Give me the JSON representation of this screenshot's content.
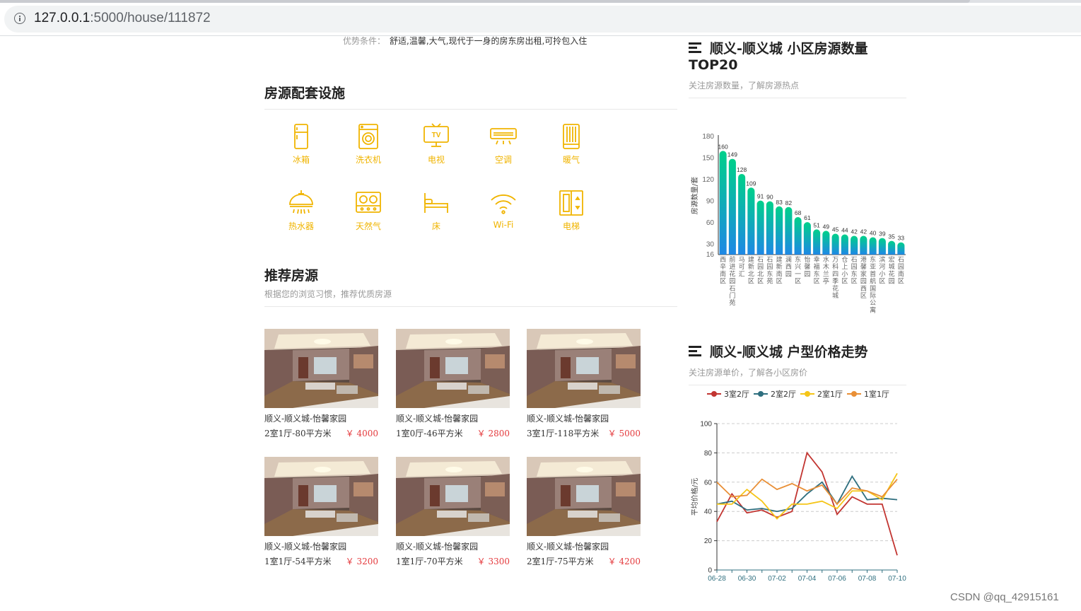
{
  "browser": {
    "url_host": "127.0.0.1",
    "url_path": ":5000/house/111872"
  },
  "advantage": {
    "label": "优势条件：",
    "value": "舒适,温馨,大气,现代于一身的房东房出租,可拎包入住"
  },
  "facilities": {
    "title": "房源配套设施",
    "items": [
      {
        "label": "冰箱",
        "icon": "fridge-icon"
      },
      {
        "label": "洗衣机",
        "icon": "washing-machine-icon"
      },
      {
        "label": "电视",
        "icon": "tv-icon"
      },
      {
        "label": "空调",
        "icon": "air-conditioner-icon"
      },
      {
        "label": "暖气",
        "icon": "heater-icon"
      },
      {
        "label": "热水器",
        "icon": "water-heater-icon"
      },
      {
        "label": "天然气",
        "icon": "gas-stove-icon"
      },
      {
        "label": "床",
        "icon": "bed-icon"
      },
      {
        "label": "Wi-Fi",
        "icon": "wifi-icon"
      },
      {
        "label": "电梯",
        "icon": "elevator-icon"
      }
    ]
  },
  "recommend": {
    "title": "推荐房源",
    "subtitle": "根据您的浏览习惯，推荐优质房源",
    "houses": [
      {
        "name": "顺义-顺义城-怡馨家园",
        "layout": "2室1厅-80平方米",
        "price": "￥ 4000"
      },
      {
        "name": "顺义-顺义城-怡馨家园",
        "layout": "1室0厅-46平方米",
        "price": "￥ 2800"
      },
      {
        "name": "顺义-顺义城-怡馨家园",
        "layout": "3室1厅-118平方米",
        "price": "￥ 5000"
      },
      {
        "name": "顺义-顺义城-怡馨家园",
        "layout": "1室1厅-54平方米",
        "price": "￥ 3200"
      },
      {
        "name": "顺义-顺义城-怡馨家园",
        "layout": "1室1厅-70平方米",
        "price": "￥ 3300"
      },
      {
        "name": "顺义-顺义城-怡馨家园",
        "layout": "2室1厅-75平方米",
        "price": "￥ 4200"
      }
    ]
  },
  "top_panel": {
    "title_line1": "顺义-顺义城 小区房源数量",
    "title_line2": "TOP20",
    "subtitle": "关注房源数量，了解房源热点"
  },
  "trend_panel": {
    "title": "顺义-顺义城 户型价格走势",
    "subtitle": "关注房源单价，了解各小区房价"
  },
  "watermark": "CSDN @qq_42915161",
  "colors": {
    "accent": "#f0b400",
    "price": "#e4393c",
    "bar_top": "#00d08a",
    "bar_bottom": "#1e88e5"
  },
  "chart_data": [
    {
      "type": "bar",
      "ylabel": "房源数量/套",
      "ylim": [
        16,
        180
      ],
      "yticks": [
        16,
        30,
        60,
        90,
        120,
        150,
        180
      ],
      "categories": [
        "西辛南区",
        "前进花园石门苑",
        "马可汇",
        "建新北区",
        "石园北区",
        "石园东苑",
        "建新南区",
        "澜西园",
        "东兴一区",
        "怡馨园",
        "幸福东区",
        "水木兰亭",
        "万科四季花城",
        "仓上小区",
        "石园东区",
        "港馨家园西区",
        "东亚首航国际公寓",
        "滨河小区",
        "宏城花园",
        "石园南区"
      ],
      "values": [
        160,
        149,
        128,
        109,
        91,
        90,
        83,
        82,
        68,
        61,
        51,
        49,
        45,
        44,
        42,
        42,
        40,
        39,
        35,
        33
      ]
    },
    {
      "type": "line",
      "ylabel": "平均价格/元",
      "ylim": [
        0,
        100
      ],
      "yticks": [
        0,
        20,
        40,
        60,
        80,
        100
      ],
      "x": [
        "06-28",
        "06-29",
        "06-30",
        "07-01",
        "07-02",
        "07-03",
        "07-04",
        "07-05",
        "07-06",
        "07-07",
        "07-08",
        "07-09",
        "07-10"
      ],
      "xtick_labels": [
        "06-28",
        "06-30",
        "07-02",
        "07-04",
        "07-06",
        "07-08",
        "07-10"
      ],
      "series": [
        {
          "name": "3室2厅",
          "color": "#c23531",
          "values": [
            33,
            52,
            39,
            41,
            36,
            40,
            80,
            67,
            38,
            50,
            45,
            45,
            10
          ]
        },
        {
          "name": "2室2厅",
          "color": "#2f6f7f",
          "values": [
            45,
            47,
            41,
            42,
            40,
            42,
            52,
            60,
            45,
            64,
            48,
            49,
            48
          ]
        },
        {
          "name": "2室1厅",
          "color": "#f5c518",
          "values": [
            45,
            45,
            55,
            47,
            35,
            45,
            45,
            47,
            42,
            54,
            54,
            48,
            66
          ]
        },
        {
          "name": "1室1厅",
          "color": "#e98f36",
          "values": [
            60,
            50,
            51,
            62,
            55,
            59,
            54,
            58,
            45,
            56,
            54,
            50,
            62
          ]
        }
      ]
    }
  ]
}
